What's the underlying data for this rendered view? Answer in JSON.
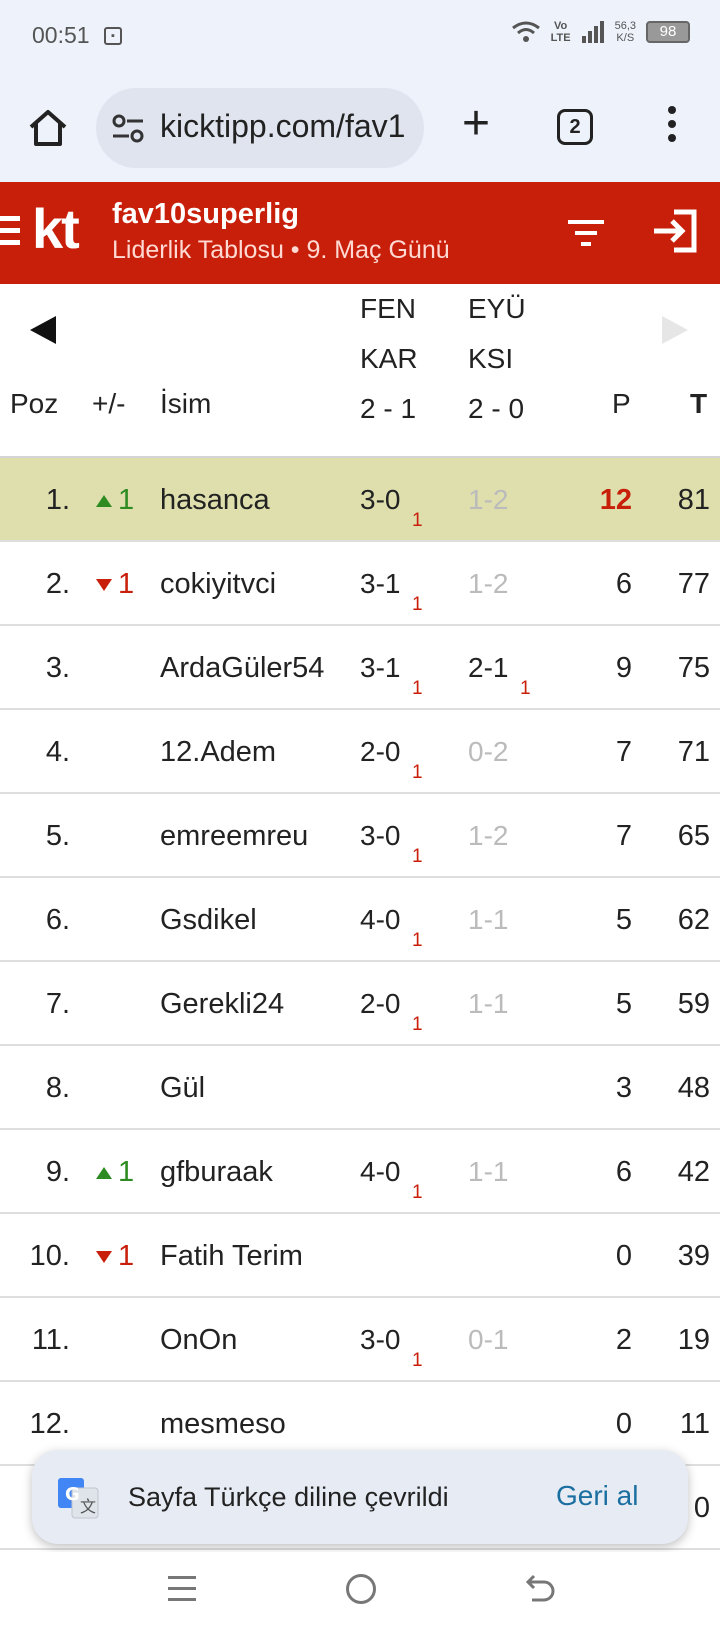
{
  "status": {
    "time": "00:51",
    "volte": "Vo\nLTE",
    "speed_value": "56,3",
    "speed_unit": "K/S",
    "battery": "98"
  },
  "browser": {
    "url": "kicktipp.com/fav1",
    "tab_count": "2"
  },
  "header": {
    "logo": "kt",
    "title": "fav10superlig",
    "subtitle": "Liderlik Tablosu • 9. Maç Günü"
  },
  "table": {
    "col_pos": "Poz",
    "col_change": "+/-",
    "col_name": "İsim",
    "col_p": "P",
    "col_t": "T",
    "matches": [
      {
        "home": "FEN",
        "away": "KAR",
        "score": "2 - 1"
      },
      {
        "home": "EYÜ",
        "away": "KSI",
        "score": "2 - 0"
      }
    ],
    "rows": [
      {
        "pos": "1.",
        "change": "1",
        "dir": "up",
        "name": "hasanca",
        "t1": "3-0",
        "t1pts": "1",
        "t2": "1-2",
        "t2pts": "",
        "p": "12",
        "t": "81",
        "highlight": true
      },
      {
        "pos": "2.",
        "change": "1",
        "dir": "down",
        "name": "cokiyitvci",
        "t1": "3-1",
        "t1pts": "1",
        "t2": "1-2",
        "t2pts": "",
        "p": "6",
        "t": "77"
      },
      {
        "pos": "3.",
        "change": "",
        "dir": "",
        "name": "ArdaGüler54",
        "t1": "3-1",
        "t1pts": "1",
        "t2": "2-1",
        "t2pts": "1",
        "p": "9",
        "t": "75"
      },
      {
        "pos": "4.",
        "change": "",
        "dir": "",
        "name": "12.Adem",
        "t1": "2-0",
        "t1pts": "1",
        "t2": "0-2",
        "t2pts": "",
        "p": "7",
        "t": "71"
      },
      {
        "pos": "5.",
        "change": "",
        "dir": "",
        "name": "emreemreu",
        "t1": "3-0",
        "t1pts": "1",
        "t2": "1-2",
        "t2pts": "",
        "p": "7",
        "t": "65"
      },
      {
        "pos": "6.",
        "change": "",
        "dir": "",
        "name": "Gsdikel",
        "t1": "4-0",
        "t1pts": "1",
        "t2": "1-1",
        "t2pts": "",
        "p": "5",
        "t": "62"
      },
      {
        "pos": "7.",
        "change": "",
        "dir": "",
        "name": "Gerekli24",
        "t1": "2-0",
        "t1pts": "1",
        "t2": "1-1",
        "t2pts": "",
        "p": "5",
        "t": "59"
      },
      {
        "pos": "8.",
        "change": "",
        "dir": "",
        "name": "Gül",
        "t1": "",
        "t1pts": "",
        "t2": "",
        "t2pts": "",
        "p": "3",
        "t": "48"
      },
      {
        "pos": "9.",
        "change": "1",
        "dir": "up",
        "name": "gfburaak",
        "t1": "4-0",
        "t1pts": "1",
        "t2": "1-1",
        "t2pts": "",
        "p": "6",
        "t": "42"
      },
      {
        "pos": "10.",
        "change": "1",
        "dir": "down",
        "name": "Fatih Terim",
        "t1": "",
        "t1pts": "",
        "t2": "",
        "t2pts": "",
        "p": "0",
        "t": "39"
      },
      {
        "pos": "11.",
        "change": "",
        "dir": "",
        "name": "OnOn",
        "t1": "3-0",
        "t1pts": "1",
        "t2": "0-1",
        "t2pts": "",
        "p": "2",
        "t": "19"
      },
      {
        "pos": "12.",
        "change": "",
        "dir": "",
        "name": "mesmeso",
        "t1": "",
        "t1pts": "",
        "t2": "",
        "t2pts": "",
        "p": "0",
        "t": "11"
      },
      {
        "pos": "",
        "change": "",
        "dir": "",
        "name": "",
        "t1": "",
        "t1pts": "",
        "t2": "",
        "t2pts": "",
        "p": "",
        "t": "0"
      }
    ]
  },
  "toast": {
    "message": "Sayfa Türkçe diline çevrildi",
    "undo": "Geri al"
  },
  "colors": {
    "brand_red": "#c81f0a",
    "highlight_row": "#dfdfae",
    "up_green": "#2e8b22",
    "link_blue": "#1a6fa0"
  }
}
